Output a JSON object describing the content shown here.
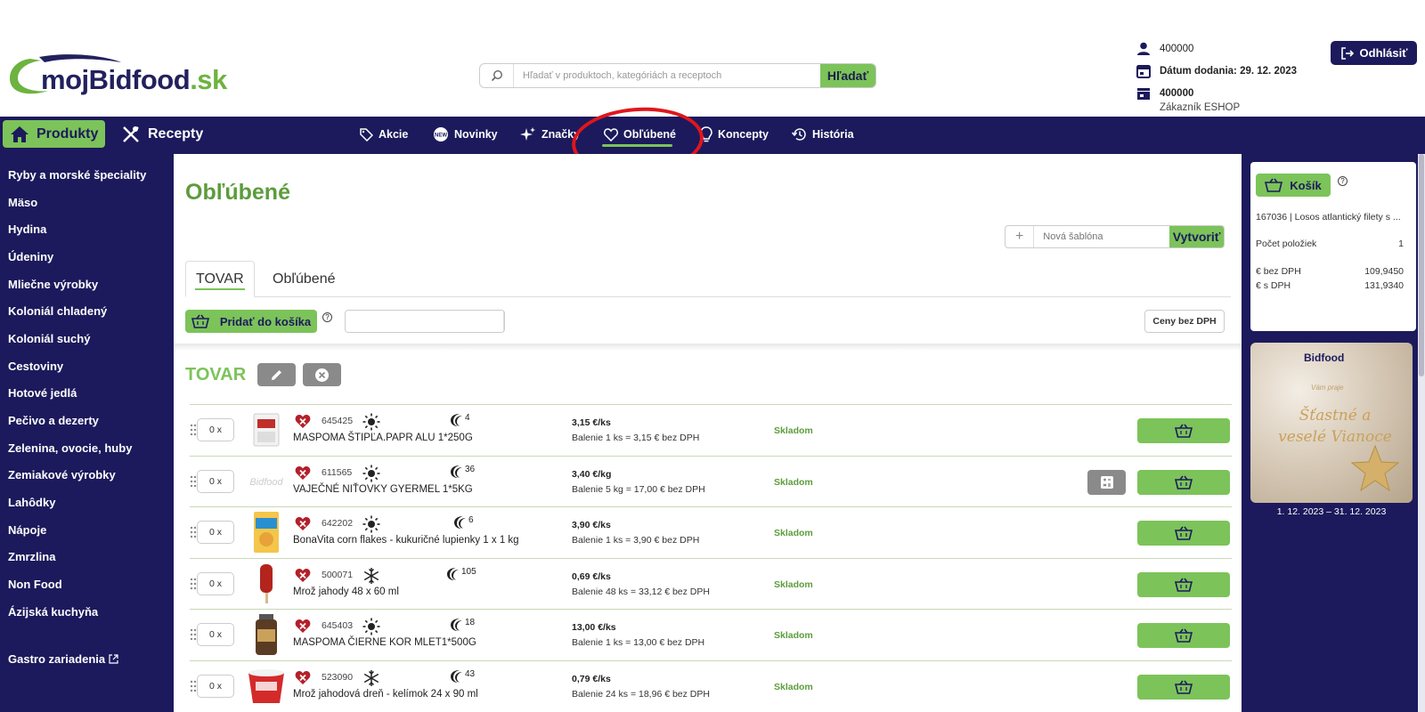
{
  "brand": {
    "logo_main": "mojBidfood",
    "logo_tld": ".sk"
  },
  "search": {
    "placeholder": "Hľadať v produktoch, kategóriách a receptoch",
    "button": "Hľadať"
  },
  "user": {
    "account": "400000",
    "delivery_date": "Dátum dodania: 29. 12. 2023",
    "store": "400000",
    "store_sub": "Zákazník ESHOP"
  },
  "logout_label": "Odhlásiť",
  "nav": {
    "produkty": "Produkty",
    "recepty": "Recepty",
    "items": [
      {
        "label": "Akcie",
        "icon": "tag-icon"
      },
      {
        "label": "Novinky",
        "icon": "new-badge-icon"
      },
      {
        "label": "Značky",
        "icon": "sparkle-icon"
      },
      {
        "label": "Obľúbené",
        "icon": "heart-icon"
      },
      {
        "label": "Koncepty",
        "icon": "lightbulb-icon"
      },
      {
        "label": "História",
        "icon": "history-icon"
      }
    ]
  },
  "sidebar": {
    "categories": [
      "Ryby a morské špeciality",
      "Mäso",
      "Hydina",
      "Údeniny",
      "Mliečne výrobky",
      "Koloniál chladený",
      "Koloniál suchý",
      "Cestoviny",
      "Hotové jedlá",
      "Pečivo a dezerty",
      "Zelenina, ovocie, huby",
      "Zemiakové výrobky",
      "Lahôdky",
      "Nápoje",
      "Zmrzlina",
      "Non Food",
      "Ázijská kuchyňa"
    ],
    "gastro": "Gastro zariadenia"
  },
  "page": {
    "title": "Obľúbené",
    "template_placeholder": "Nová šablóna",
    "template_button": "Vytvoriť",
    "tabs": [
      "TOVAR",
      "Obľúbené"
    ],
    "add_to_cart": "Pridať do košíka",
    "prices_toggle": "Ceny bez DPH",
    "section_title": "TOVAR"
  },
  "products": [
    {
      "qty": "0 x",
      "code": "645425",
      "temp": "ambient",
      "days": "4",
      "name": "MASPOMA ŠTIPĽA.PAPR ALU 1*250G",
      "price": "3,15 €/ks",
      "pack": "Balenie 1 ks = 3,15 € bez DPH",
      "stock": "Skladom",
      "calc": false
    },
    {
      "qty": "0 x",
      "code": "611565",
      "temp": "ambient",
      "days": "36",
      "name": "VAJEČNÉ NIŤOVKY GYERMEL 1*5KG",
      "price": "3,40 €/kg",
      "pack": "Balenie 5 kg = 17,00 € bez DPH",
      "stock": "Skladom",
      "calc": true
    },
    {
      "qty": "0 x",
      "code": "642202",
      "temp": "ambient",
      "days": "6",
      "name": "BonaVita corn flakes - kukuričné lupienky 1 x 1 kg",
      "price": "3,90 €/ks",
      "pack": "Balenie 1 ks = 3,90 € bez DPH",
      "stock": "Skladom",
      "calc": false
    },
    {
      "qty": "0 x",
      "code": "500071",
      "temp": "frozen",
      "days": "105",
      "name": "Mrož jahody 48 x 60 ml",
      "price": "0,69 €/ks",
      "pack": "Balenie 48 ks = 33,12 € bez DPH",
      "stock": "Skladom",
      "calc": false
    },
    {
      "qty": "0 x",
      "code": "645403",
      "temp": "ambient",
      "days": "18",
      "name": "MASPOMA ČIERNE KOR MLET1*500G",
      "price": "13,00 €/ks",
      "pack": "Balenie 1 ks = 13,00 € bez DPH",
      "stock": "Skladom",
      "calc": false
    },
    {
      "qty": "0 x",
      "code": "523090",
      "temp": "frozen",
      "days": "43",
      "name": "Mrož jahodová dreň - kelímok 24 x 90 ml",
      "price": "0,79 €/ks",
      "pack": "Balenie 24 ks = 18,96 € bez DPH",
      "stock": "Skladom",
      "calc": false
    }
  ],
  "cart": {
    "label": "Košík",
    "item": "167036 | Losos atlantický filety s ...",
    "count_label": "Počet položiek",
    "count": "1",
    "net_label": "€ bez DPH",
    "net": "109,9450",
    "gross_label": "€ s DPH",
    "gross": "131,9340"
  },
  "promo": {
    "logo": "Bidfood",
    "small": "Vám praje",
    "text": "Šťastné a veselé Vianoce",
    "dates": "1. 12. 2023 – 31. 12. 2023"
  },
  "colors": {
    "navy": "#1c1a5c",
    "green": "#7cc35a",
    "title_green": "#5c9c3c",
    "highlight_red": "#e0161d"
  }
}
